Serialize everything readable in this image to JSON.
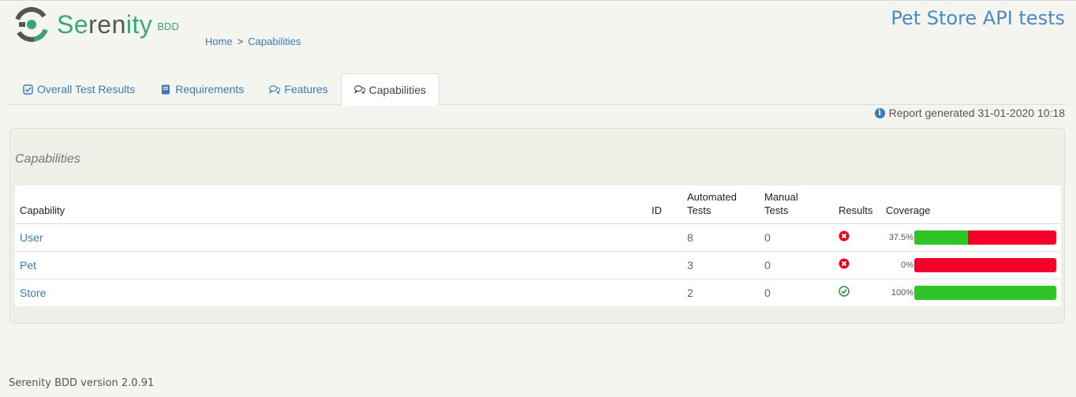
{
  "header": {
    "logo_prefix": "Se",
    "logo_middle": "ren",
    "logo_suffix": "ity",
    "logo_bdd": "BDD",
    "project_title": "Pet Store API tests",
    "breadcrumb": {
      "home": "Home",
      "separator": ">",
      "current": "Capabilities"
    }
  },
  "tabs": [
    {
      "label": "Overall Test Results",
      "icon": "checkbox-icon",
      "active": false
    },
    {
      "label": "Requirements",
      "icon": "book-icon",
      "active": false
    },
    {
      "label": "Features",
      "icon": "comments-icon",
      "active": false
    },
    {
      "label": "Capabilities",
      "icon": "comments-icon",
      "active": true
    }
  ],
  "report": {
    "generated": "Report generated 31-01-2020 10:18"
  },
  "panel": {
    "title": "Capabilities",
    "columns": {
      "capability": "Capability",
      "id": "ID",
      "automated_1": "Automated",
      "automated_2": "Tests",
      "manual_1": "Manual",
      "manual_2": "Tests",
      "results": "Results",
      "coverage": "Coverage"
    },
    "rows": [
      {
        "name": "User",
        "id": "",
        "automated": "8",
        "manual": "0",
        "result": "failure",
        "coverage_label": "37.5%",
        "coverage": 0.375
      },
      {
        "name": "Pet",
        "id": "",
        "automated": "3",
        "manual": "0",
        "result": "failure",
        "coverage_label": "0%",
        "coverage": 0
      },
      {
        "name": "Store",
        "id": "",
        "automated": "2",
        "manual": "0",
        "result": "success",
        "coverage_label": "100%",
        "coverage": 1
      }
    ]
  },
  "colors": {
    "pass": "#2fc526",
    "fail": "#f4002a",
    "link": "#3a7ab7",
    "brand": "#3aa57a"
  },
  "footer": {
    "version": "Serenity BDD version 2.0.91"
  }
}
